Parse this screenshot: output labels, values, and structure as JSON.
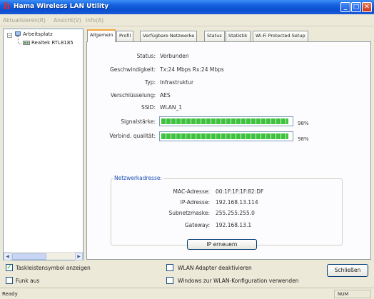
{
  "window": {
    "title": "Hama Wireless LAN Utility",
    "logo_letter": "h"
  },
  "menu": [
    "Aktualisieren(R)",
    "Ansicht(V)",
    "Info(A)"
  ],
  "tree": {
    "root_label": "Arbeitsplatz",
    "child_label": "Realtek RTL8185"
  },
  "tabs": [
    "Allgemein",
    "Profil",
    "Verfügbare Netzwerke",
    "Status",
    "Statistik",
    "Wi-Fi Protected Setup"
  ],
  "general": {
    "status_label": "Status:",
    "status_value": "Verbunden",
    "speed_label": "Geschwindigkeit:",
    "speed_value": "Tx:24 Mbps Rx:24 Mbps",
    "type_label": "Typ:",
    "type_value": "Infrastruktur",
    "encryption_label": "Verschlüsselung:",
    "encryption_value": "AES",
    "ssid_label": "SSID:",
    "ssid_value": "WLAN_1",
    "signal_label": "Signalstärke:",
    "signal_percent_text": "98%",
    "signal_level": 0.98,
    "quality_label": "Verbind. qualität:",
    "quality_percent_text": "98%",
    "quality_level": 0.98
  },
  "network": {
    "group_title": "Netzwerkadresse:",
    "mac_label": "MAC-Adresse:",
    "mac_value": "00:1F:1F:1F:82:DF",
    "ip_label": "IP-Adresse:",
    "ip_value": "192.168.13.114",
    "subnet_label": "Subnetzmaske:",
    "subnet_value": "255.255.255.0",
    "gateway_label": "Gateway:",
    "gateway_value": "192.168.13.1",
    "renew_button": "IP erneuern"
  },
  "options": {
    "tray_icon_label": "Taskleistensymbol anzeigen",
    "tray_icon_checked": true,
    "radio_off_label": "Funk aus",
    "radio_off_checked": false,
    "disable_adapter_label": "WLAN Adapter deaktivieren",
    "disable_adapter_checked": false,
    "use_windows_label": "Windows zur WLAN-Konfiguration verwenden",
    "use_windows_checked": false
  },
  "close_button": "Schließen",
  "statusbar": {
    "text": "Ready",
    "indicator": "NUM"
  },
  "colors": {
    "title_bar": "#0a4fd0",
    "signal_green": "#3cc43c",
    "group_title": "#1d4fb4",
    "tab_highlight": "#f3a73b"
  }
}
